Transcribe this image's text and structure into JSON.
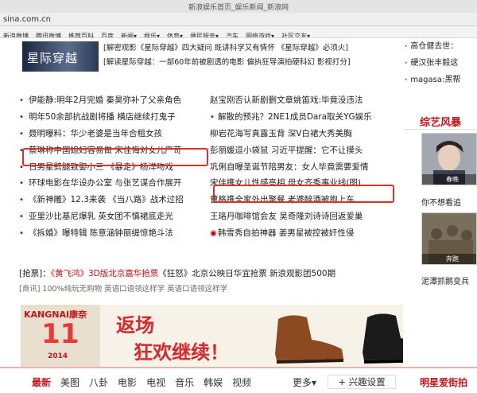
{
  "browser": {
    "title": "新浪娱乐首页_娱乐新闻_新浪网",
    "url": "sina.com.cn",
    "bookmarks": [
      "新浪微博",
      "腾讯微博",
      "推荐百科",
      "百度",
      "新闻▾",
      "娱乐▾",
      "体育▾",
      "便民服务▾",
      "汽车",
      "网络游戏▾",
      "社区交友▾"
    ]
  },
  "header": {
    "logo_text": "星际穿越",
    "promo_lines": [
      "[解密观影《星际穿越》四大疑问 既讲科学又有情怀 《星际穿越》必须火]",
      "[解读星际穿越：一部60年前被剧透的电影 偏执狂导演拍硬科幻  影视打分]"
    ]
  },
  "news": {
    "left": [
      "伊能静:明年2月完婚 秦昊弥补了父亲角色",
      "明年50余部抗战剧将播 横店继续打鬼子",
      "聂明曝料：华少老婆是当年合租女孩",
      "蔡琳称中国媳妇容易做 宋佳悔对女儿严苛",
      "日男星劈腿致娶小三  《暴走》杨洋吻戏",
      "环球电影在华设办公室 与张艺谋合作展开",
      "《新神雕》12.3来袭  《当八路》战术过招",
      "亚里沙比基尼爆乳  英女团不慎裙底走光",
      "《拆婚》曝特辑 陈意涵钟丽缇惊艳斗法"
    ],
    "mid": [
      "赵宝刚否认新剧删文章姚笛戏:毕竟没违法",
      "解散的预兆？2NE1成员Dara取关YG娱乐",
      "柳岩花海写真露玉背 深V白裙大秀美胸",
      "彭丽媛逗小袋鼠 习近平提醒：它不让摸头",
      "巩俐自曝圣诞节陪男友：女人毕竟需要爱情",
      "宋佳携女儿性感亮相 母女齐秀事业线(图)",
      "曹格携全家外出聚餐 老婆醉酒被抱上车",
      "王珞丹咖啡馆会友  吴奇隆刘诗诗回返爱巢",
      "韩雪秀自拍神器    姜男星被控被奸性侵"
    ],
    "row_special_prefix": "[抢票]：",
    "row_special_red": "《黄飞鸿》3D版北京嘉华抢票",
    "row_special_rest": "《狂怒》北京公映日华宜抢票  新浪观影团500期",
    "ad_row": "[商讯]  100%纯玩无购物 英语口语领这样学 英语口语领这样学"
  },
  "sidebar": {
    "top_items": [
      "高仓健去世：",
      "硬汉张丰毅这",
      "magasa:黑帮"
    ],
    "section_title": "综艺风暴",
    "thumb1_caption": "你不想看追",
    "thumb1_overlay": "春晚",
    "thumb2_caption": "泥潭抓鹅变兵",
    "thumb2_overlay": "奔跑"
  },
  "banner": {
    "brand": "KANGNAI康奈",
    "big_number": "11",
    "year": "2014",
    "headline1": "返场",
    "headline2": "狂欢继续！"
  },
  "nav": {
    "tabs": [
      "最新",
      "美图",
      "八卦",
      "电影",
      "电视",
      "音乐",
      "韩娱",
      "视频"
    ],
    "more": "更多▾",
    "settings": "+ 兴趣设置",
    "side_title": "明星爱街拍"
  },
  "colors": {
    "accent": "#c4161c",
    "box": "#d9342c"
  }
}
